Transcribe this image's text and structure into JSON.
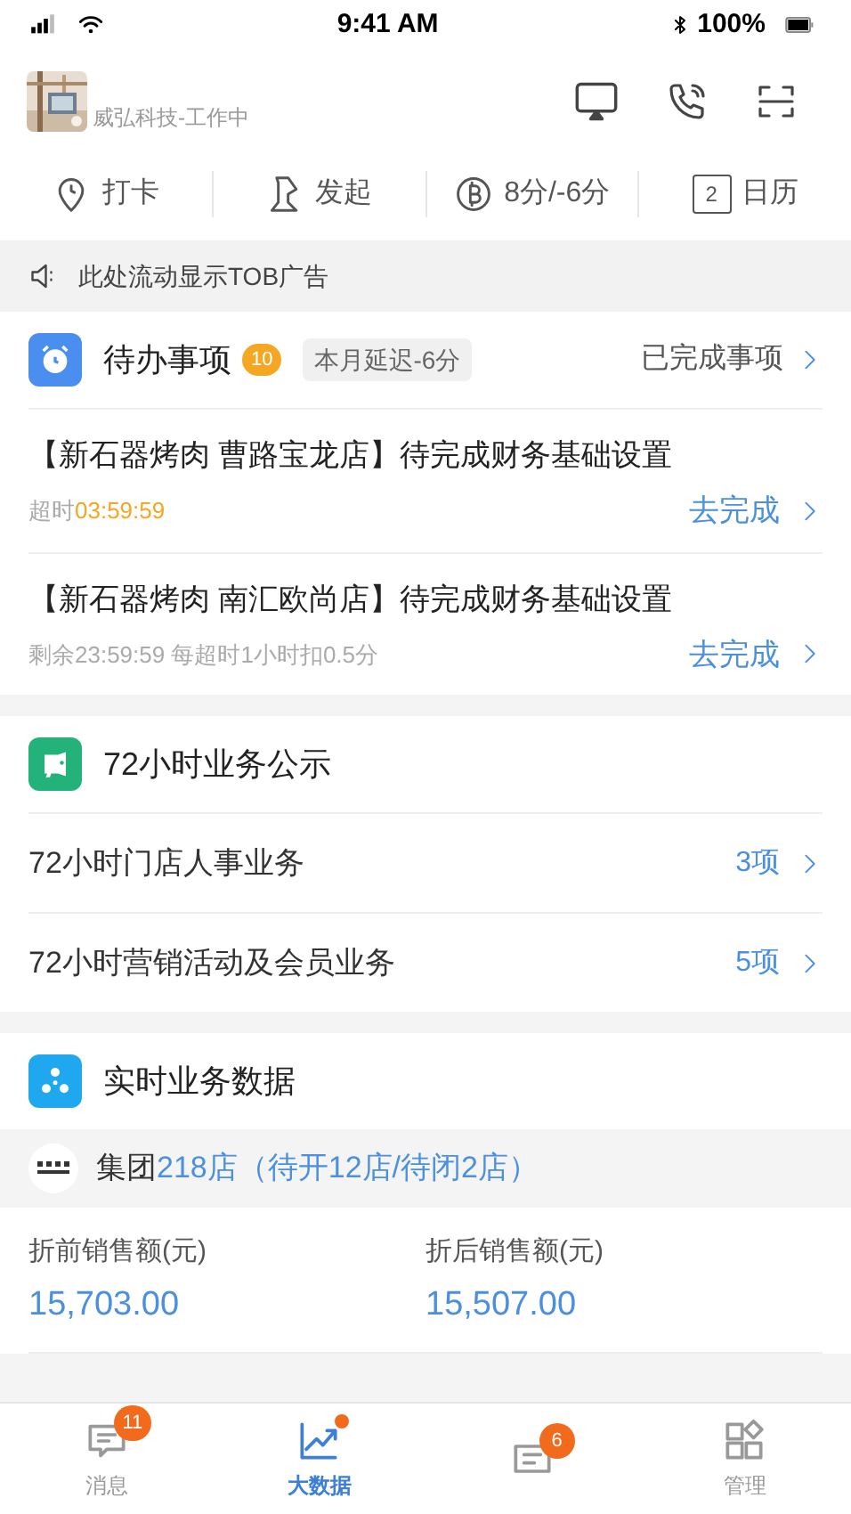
{
  "status_bar": {
    "time": "9:41 AM",
    "battery": "100%"
  },
  "header": {
    "company": "威弘科技-工作中"
  },
  "quick_actions": [
    {
      "kind": "pin",
      "label": "打卡"
    },
    {
      "kind": "launch",
      "label": "发起"
    },
    {
      "kind": "score",
      "label": "8分/-6分"
    },
    {
      "kind": "calendar",
      "label": "日历",
      "icon_text": "2"
    }
  ],
  "ad_bar": {
    "text": "此处流动显示TOB广告"
  },
  "todo": {
    "title": "待办事项",
    "count": "10",
    "delay_tag": "本月延迟-6分",
    "done_link": "已完成事项",
    "items": [
      {
        "title": "【新石器烤肉 曹路宝龙店】待完成财务基础设置",
        "status": "超时",
        "time": "03:59:59",
        "overdue": true,
        "action": "去完成"
      },
      {
        "title": "【新石器烤肉 南汇欧尚店】待完成财务基础设置",
        "status": "剩余",
        "time": "23:59:59 每超时1小时扣0.5分",
        "overdue": false,
        "action": "去完成"
      }
    ]
  },
  "notice": {
    "title": "72小时业务公示",
    "rows": [
      {
        "label": "72小时门店人事业务",
        "count": "3项"
      },
      {
        "label": "72小时营销活动及会员业务",
        "count": "5项"
      }
    ]
  },
  "realtime": {
    "title": "实时业务数据",
    "group_label": "集团",
    "group_stats": "218店（待开12店/待闭2店）",
    "metrics": [
      {
        "label": "折前销售额(元)",
        "value": "15,703.00"
      },
      {
        "label": "折后销售额(元)",
        "value": "15,507.00"
      }
    ]
  },
  "tab_bar": [
    {
      "kind": "message",
      "label": "消息",
      "badge": "11",
      "selected": false,
      "dot": false
    },
    {
      "kind": "chart",
      "label": "大数据",
      "selected": true,
      "dot": true
    },
    {
      "kind": "ops",
      "badge": "6",
      "selected": false,
      "dot": false
    },
    {
      "kind": "manage",
      "label": "管理",
      "selected": false,
      "dot": false
    }
  ]
}
